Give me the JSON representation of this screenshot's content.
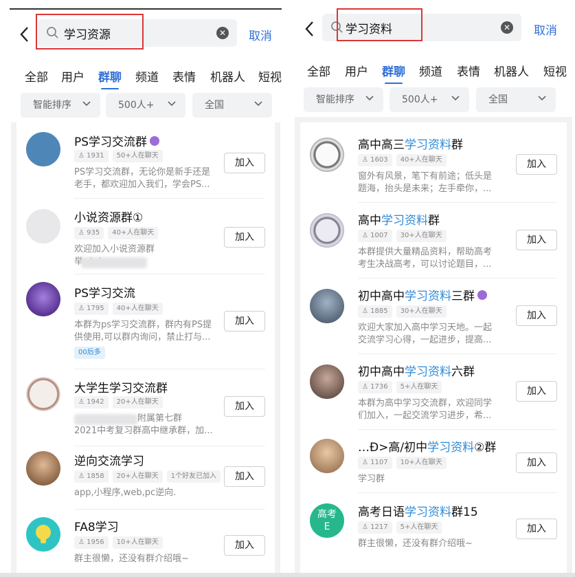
{
  "left": {
    "search": {
      "query": "学习资源",
      "cancel": "取消"
    },
    "tabs": [
      "全部",
      "用户",
      "群聊",
      "频道",
      "表情",
      "机器人",
      "短视"
    ],
    "filters": [
      "智能排序",
      "500人+",
      "全国"
    ],
    "items": [
      {
        "name": "PS学习交流群",
        "badge": true,
        "count": "1931",
        "online": "50+人在聊天",
        "extra": "",
        "desc1": "PS学习交流群，无论你是新手还是",
        "desc2": "老手，都欢迎加入我们，学会PS...",
        "tag": "",
        "join": "加入",
        "avatar_color": "#4f86b8"
      },
      {
        "name": "小说资源群①",
        "badge": false,
        "count": "935",
        "online": "40+人在聊天",
        "extra": "",
        "desc1": "欢迎加入小说资源群",
        "desc2": "举              ·！！...",
        "tag": "",
        "join": "加入",
        "avatar_color": "#dcdcdc"
      },
      {
        "name": "PS学习交流",
        "badge": false,
        "count": "1795",
        "online": "40+人在聊天",
        "extra": "",
        "desc1": "本群为ps学习交流群，群内有PS提",
        "desc2": "供使用,可以群内询问，禁止打与...",
        "tag": "00后多",
        "join": "加入",
        "avatar_color": "#5a2da0"
      },
      {
        "name": "大学生学习交流群",
        "badge": false,
        "count": "1942",
        "online": "20+人在聊天",
        "extra": "",
        "desc1": "附属第七群",
        "desc2": "2021中考复习群高中继承群，加...",
        "tag": "",
        "join": "加入",
        "avatar_color": "#b9a49a"
      },
      {
        "name": "逆向交流学习",
        "badge": false,
        "count": "1858",
        "online": "20+人在聊天",
        "extra": "1个好友已加入",
        "desc1": "app,小程序,web,pc逆向.",
        "desc2": "",
        "tag": "",
        "join": "加入",
        "avatar_color": "#9c6b45"
      },
      {
        "name": "FA8学习",
        "badge": false,
        "count": "1956",
        "online": "10+人在聊天",
        "extra": "",
        "desc1": "群主很懒，还没有群介绍哦~",
        "desc2": "",
        "tag": "",
        "join": "加入",
        "avatar_color": "#2fc4c4"
      }
    ]
  },
  "right": {
    "search": {
      "query": "学习资料",
      "cancel": "取消"
    },
    "tabs": [
      "全部",
      "用户",
      "群聊",
      "频道",
      "表情",
      "机器人",
      "短视"
    ],
    "filters": [
      "智能排序",
      "500人+",
      "全国"
    ],
    "items": [
      {
        "pre": "高中高三",
        "hl": "学习资料",
        "post": "群",
        "badge": false,
        "count": "1603",
        "online": "40+人在聊天",
        "desc1": "窗外有风景，笔下有前途；低头是",
        "desc2": "题海，抬头是未来；左手牵你，...",
        "join": "加入",
        "avatar_color": "#cfcfd6"
      },
      {
        "pre": "高中",
        "hl": "学习资料",
        "post": "群",
        "badge": false,
        "count": "1007",
        "online": "30+人在聊天",
        "desc1": "本群提供大量精品资料，帮助高考",
        "desc2": "考生决战高考，可以讨论题目，...",
        "join": "加入",
        "avatar_color": "#d6d2e0"
      },
      {
        "pre": "初中高中",
        "hl": "学习资料",
        "post": "三群",
        "badge": true,
        "count": "1885",
        "online": "30+人在聊天",
        "desc1": "欢迎大家加入高中学习天地。一起",
        "desc2": "交流学习心得，一起进步，提高...",
        "join": "加入",
        "avatar_color": "#5a6d80"
      },
      {
        "pre": "初中高中",
        "hl": "学习资料",
        "post": "六群",
        "badge": false,
        "count": "1736",
        "online": "5+人在聊天",
        "desc1": "本群为高中学习交流群，欢迎同学",
        "desc2": "们加入，一起交流学习进步，希...",
        "join": "加入",
        "avatar_color": "#6a5448"
      },
      {
        "pre": "…Ð>高/初中",
        "hl": "学习资料",
        "post": "②群",
        "badge": false,
        "count": "1107",
        "online": "10+人在聊天",
        "desc1": "学习群",
        "desc2": "",
        "join": "加入",
        "avatar_color": "#c79a6e"
      },
      {
        "pre": "高考日语",
        "hl": "学习资料",
        "post": "群15",
        "badge": false,
        "count": "1217",
        "online": "5+人在聊天",
        "desc1": "群主很懒，还没有群介绍哦~",
        "desc2": "",
        "join": "加入",
        "avatar_color": "#27b78d"
      }
    ]
  },
  "avatar_texts": {
    "right_last": "高考\nE"
  },
  "colors": {
    "accent": "#2f6fd6",
    "highlight": "#2f8ad8",
    "annotation": "#d93636"
  }
}
